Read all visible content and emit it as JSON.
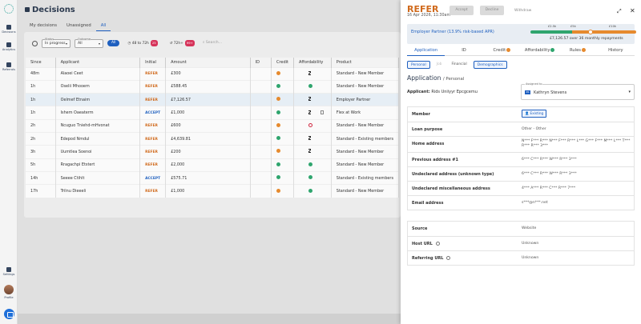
{
  "rail": {
    "items": [
      {
        "label": "Decisions"
      },
      {
        "label": "Analytics"
      },
      {
        "label": "Referrals"
      },
      {
        "label": "Settings"
      },
      {
        "label": "Profile"
      }
    ]
  },
  "page": {
    "title": "Decisions",
    "tabs": [
      "My decisions",
      "Unassigned",
      "All"
    ],
    "active_tab": "All"
  },
  "filters": {
    "status_legend": "Status",
    "status_value": "In progress",
    "outcome_legend": "Outcome",
    "outcome_value": "All",
    "pill_all": "All",
    "pill_48": "48 to 72h",
    "pill_48_count": "25",
    "pill_72": "72h+",
    "pill_72_count": "99+",
    "search_placeholder": "Search..."
  },
  "table": {
    "headers": [
      "Since",
      "Applicant",
      "Initial",
      "Amount",
      "ID",
      "Credit",
      "Affordability",
      "Product"
    ],
    "rows": [
      {
        "since": "48m",
        "applicant": "Alaoei Ceet",
        "initial": "REFER",
        "amount": "£300",
        "credit": "orange",
        "afford": "hourglass",
        "doc": false,
        "product": "Standard - New Member"
      },
      {
        "since": "1h",
        "applicant": "Oselii Mhooem",
        "initial": "REFER",
        "amount": "£588.45",
        "credit": "green",
        "afford": "green",
        "doc": false,
        "product": "Standard - New Member"
      },
      {
        "since": "1h",
        "applicant": "Oelmef Etnaim",
        "initial": "REFER",
        "amount": "£7,126.57",
        "credit": "orange",
        "afford": "hourglass",
        "doc": false,
        "product": "Employer Partner",
        "highlight": true
      },
      {
        "since": "1h",
        "applicant": "Ishem Oaeaterm",
        "initial": "ACCEPT",
        "amount": "£1,000",
        "credit": "green",
        "afford": "hourglass",
        "doc": true,
        "product": "Flex at Work"
      },
      {
        "since": "2h",
        "applicant": "Ncuguo Tniehd-mHvonat",
        "initial": "REFER",
        "amount": "£600",
        "credit": "orange",
        "afford": "ban",
        "doc": false,
        "product": "Standard - New Member"
      },
      {
        "since": "2h",
        "applicant": "Edepod Nmdul",
        "initial": "REFER",
        "amount": "£4,639.81",
        "credit": "green",
        "afford": "hourglass",
        "doc": false,
        "product": "Standard - Existing members"
      },
      {
        "since": "3h",
        "applicant": "Uumtlea Soenoi",
        "initial": "REFER",
        "amount": "£200",
        "credit": "orange",
        "afford": "hourglass",
        "doc": false,
        "product": "Standard - New Member"
      },
      {
        "since": "5h",
        "applicant": "Rragachpi Etstert",
        "initial": "REFER",
        "amount": "£2,000",
        "credit": "green",
        "afford": "green",
        "doc": false,
        "product": "Standard - New Member"
      },
      {
        "since": "14h",
        "applicant": "Seeee Ctihlt",
        "initial": "ACCEPT",
        "amount": "£575.71",
        "credit": "green",
        "afford": "green",
        "doc": false,
        "product": "Standard - Existing members"
      },
      {
        "since": "17h",
        "applicant": "Trilnu Dieeeli",
        "initial": "REFER",
        "amount": "£1,000",
        "credit": "orange",
        "afford": "green",
        "doc": false,
        "product": "Standard - New Member"
      }
    ]
  },
  "panel": {
    "verdict": "REFER",
    "date": "16 Apr 2026, 11:30am",
    "accept_label": "Accept",
    "decline_label": "Decline",
    "withdraw_label": "Withdraw",
    "price_label": "Employer Partner (13.9% risk-based APR)",
    "tick_1": "£2.5k",
    "tick_2": "£5k",
    "tick_3": "£10k",
    "price_summary": "£7,126.57 over 36 monthly repayments",
    "price_colors": {
      "green": "#2fa56e",
      "orange": "#e68a2e"
    },
    "tabs": [
      {
        "label": "Application",
        "badge": null
      },
      {
        "label": "ID",
        "badge": null
      },
      {
        "label": "Credit",
        "badge": "orange"
      },
      {
        "label": "Affordability",
        "badge": "green"
      },
      {
        "label": "Rules",
        "badge": "orange"
      },
      {
        "label": "History",
        "badge": null
      }
    ],
    "subtabs": [
      "Personal",
      "Job",
      "Financial",
      "Demographics"
    ],
    "section_title": "Application",
    "section_sub": "/ Personal",
    "applicant_label": "Applicant:",
    "applicant_name": "Rids Uniiyyr Epcgcemu",
    "assigned_legend": "Assigned to",
    "assigned_initials": "KS",
    "assigned_name": "Kathryn Stevens",
    "fields": [
      {
        "k": "Member",
        "v": "Existing",
        "tag": true
      },
      {
        "k": "Loan purpose",
        "v": "Other - Other"
      },
      {
        "k": "Home address",
        "v": "N*** F*** R*** N*** F*** R*** L*** G*** F*** M*** L*** T*** R*** R*** 3***"
      },
      {
        "k": "Previous address #1",
        "v": "6*** C*** R*** W*** R*** 3***"
      },
      {
        "k": "Undeclared address (unknown type)",
        "v": "6*** C*** R*** W*** R*** 3***"
      },
      {
        "k": "Undeclared miscellaneous address",
        "v": "4*** A*** R*** C*** R*** 7***"
      },
      {
        "k": "Email address",
        "v": "s***@n***.net"
      }
    ],
    "fields2": [
      {
        "k": "Source",
        "v": "Website",
        "info": false
      },
      {
        "k": "Host URL",
        "v": "Unknown",
        "info": true
      },
      {
        "k": "Referring URL",
        "v": "Unknown",
        "info": true
      }
    ]
  }
}
